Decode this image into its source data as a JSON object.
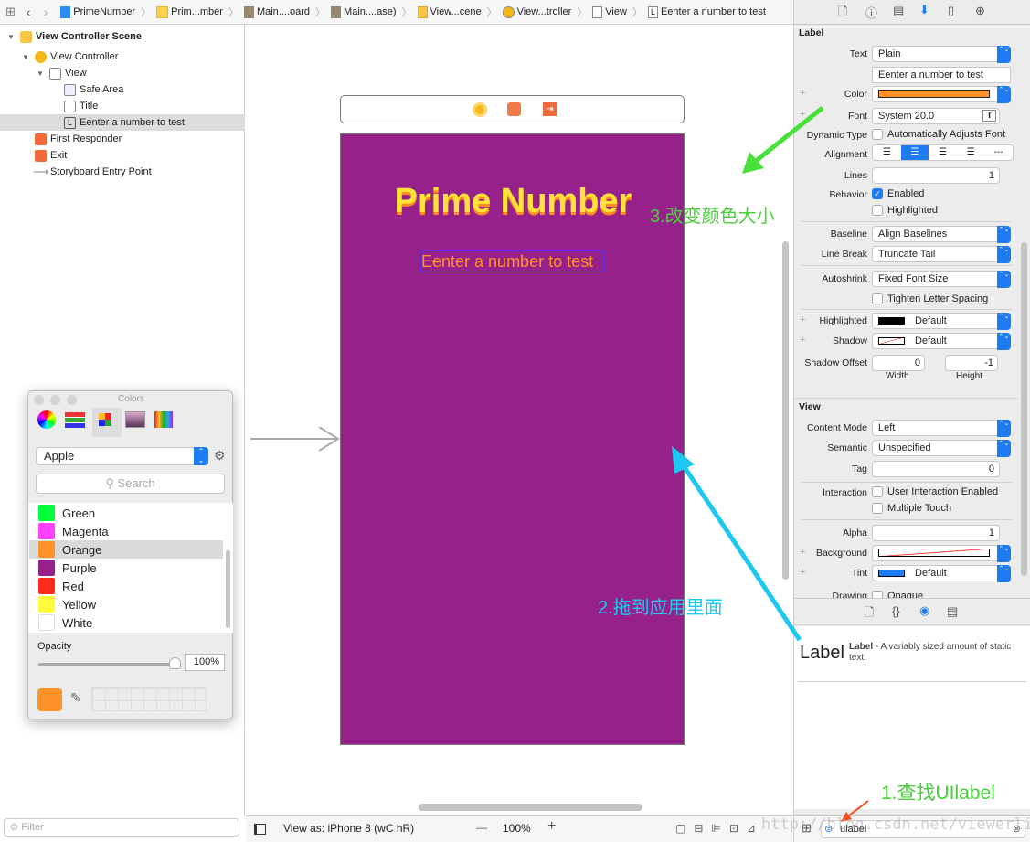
{
  "breadcrumb": [
    "PrimeNumber",
    "Prim...mber",
    "Main....oard",
    "Main....ase)",
    "View...cene",
    "View...troller",
    "View",
    "Eenter a number to test"
  ],
  "outline": {
    "items": [
      {
        "label": "View Controller Scene",
        "icon": "scene-icon"
      },
      {
        "label": "View Controller",
        "icon": "view-controller-icon"
      },
      {
        "label": "View",
        "icon": "view-icon"
      },
      {
        "label": "Safe Area",
        "icon": "safe-area-icon"
      },
      {
        "label": "Title",
        "icon": "label-icon"
      },
      {
        "label": "Eenter a number to test",
        "icon": "label-icon",
        "selected": true
      },
      {
        "label": "First Responder",
        "icon": "first-responder-icon"
      },
      {
        "label": "Exit",
        "icon": "exit-icon"
      },
      {
        "label": "Storyboard Entry Point",
        "icon": "arrow-icon"
      }
    ],
    "filter_placeholder": "Filter"
  },
  "canvas": {
    "title": "Prime Number",
    "label_text": "Eenter a number to test",
    "background": "#97218A",
    "title_color": "#FFE23A",
    "label_color": "#FF9228"
  },
  "bottombar": {
    "view_as": "View as: iPhone 8 (",
    "size_class": "wC hR)",
    "zoom": "100%",
    "minus": "—",
    "plus": "+"
  },
  "colors_panel": {
    "title": "Colors",
    "palette": "Apple",
    "search_placeholder": "Search",
    "items": [
      {
        "name": "Green",
        "color": "#00FF3A"
      },
      {
        "name": "Magenta",
        "color": "#FF40FF"
      },
      {
        "name": "Orange",
        "color": "#FF9228",
        "selected": true
      },
      {
        "name": "Purple",
        "color": "#97218A"
      },
      {
        "name": "Red",
        "color": "#FF2A1E"
      },
      {
        "name": "Yellow",
        "color": "#FFFB3C"
      },
      {
        "name": "White",
        "color": "#FFFFFF"
      }
    ],
    "opacity_label": "Opacity",
    "opacity_value": "100%",
    "opacity_fraction": 1.0,
    "current_color": "#FF9228"
  },
  "inspector": {
    "label_section": "Label",
    "text_label": "Text",
    "text_value": "Plain",
    "text_content": "Eenter a number to test",
    "color_label": "Color",
    "color_value": "#FF9228",
    "font_label": "Font",
    "font_value": "System 20.0",
    "dynamic_label": "Dynamic Type",
    "dynamic_value": "Automatically Adjusts Font",
    "alignment_label": "Alignment",
    "lines_label": "Lines",
    "lines_value": "1",
    "behavior_label": "Behavior",
    "enabled": "Enabled",
    "highlighted": "Highlighted",
    "baseline_label": "Baseline",
    "baseline_value": "Align Baselines",
    "linebreak_label": "Line Break",
    "linebreak_value": "Truncate Tail",
    "autoshrink_label": "Autoshrink",
    "autoshrink_value": "Fixed Font Size",
    "tighten": "Tighten Letter Spacing",
    "hl_label": "Highlighted",
    "hl_value": "Default",
    "shadow_label": "Shadow",
    "shadow_value": "Default",
    "shadow_offset_label": "Shadow Offset",
    "width_value": "0",
    "height_value": "-1",
    "width_label": "Width",
    "height_label": "Height",
    "view_section": "View",
    "content_mode_label": "Content Mode",
    "content_mode_value": "Left",
    "semantic_label": "Semantic",
    "semantic_value": "Unspecified",
    "tag_label": "Tag",
    "tag_value": "0",
    "interaction_label": "Interaction",
    "user_interaction": "User Interaction Enabled",
    "multiple_touch": "Multiple Touch",
    "alpha_label": "Alpha",
    "alpha_value": "1",
    "background_label": "Background",
    "tint_label": "Tint",
    "tint_value": "Default",
    "drawing_label": "Drawing",
    "opaque": "Opaque"
  },
  "library": {
    "item_big": "Label",
    "item_name": "Label",
    "item_desc": " - A variably sized amount of static text.",
    "search_value": "ulabel"
  },
  "annotations": {
    "step1": "1.查找UIlabel",
    "step2": "2.拖到应用里面",
    "step3": "3.改变颜色大小",
    "watermark": "http://blog.csdn.net/viewerlin"
  }
}
